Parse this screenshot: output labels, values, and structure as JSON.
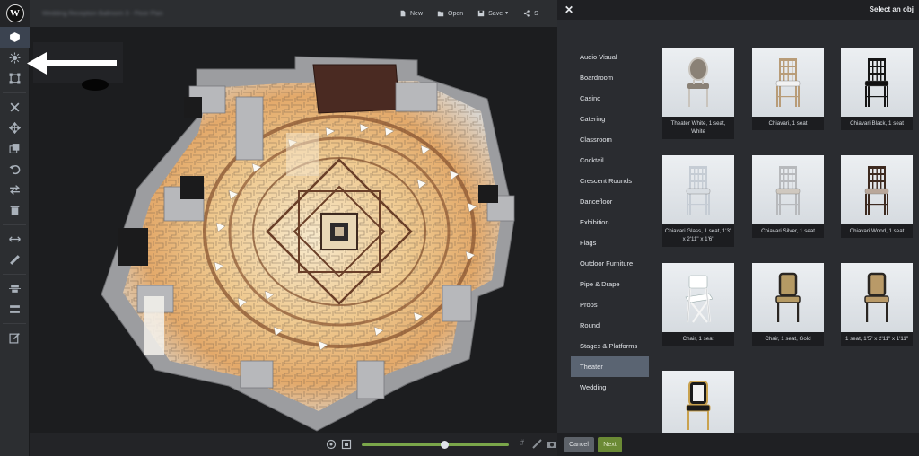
{
  "app": {
    "logo_letter": "W",
    "document_title": "Wedding Reception Ballroom 3 - Floor Plan"
  },
  "toolbar": {
    "items": [
      "cube-icon",
      "brightness-icon",
      "transform-icon",
      "close-icon",
      "move-icon",
      "copy-icon",
      "undo-icon",
      "swap-icon",
      "trash-icon",
      "resize-icon",
      "ruler-icon",
      "align-icon",
      "distribute-icon",
      "edit-icon"
    ],
    "active_index": 0
  },
  "topbar": {
    "new_label": "New",
    "open_label": "Open",
    "save_label": "Save",
    "share_label": "S"
  },
  "viewport": {
    "zoom_level": 0.56
  },
  "panel": {
    "title": "Select an obj",
    "categories": [
      "Audio Visual",
      "Boardroom",
      "Casino",
      "Catering",
      "Classroom",
      "Cocktail",
      "Crescent Rounds",
      "Dancefloor",
      "Exhibition",
      "Flags",
      "Outdoor Furniture",
      "Pipe & Drape",
      "Props",
      "Round",
      "Stages & Platforms",
      "Theater",
      "Wedding"
    ],
    "selected_category": "Theater",
    "items": [
      {
        "caption": "Theater White, 1 seat, White",
        "kind": "round-back-chair",
        "seat": "#8a8176",
        "frame": "#c9c4bd"
      },
      {
        "caption": "Chiavari, 1 seat",
        "kind": "chiavari",
        "seat": "#f2f2f2",
        "frame": "#b89c78"
      },
      {
        "caption": "Chiavari Black, 1 seat",
        "kind": "chiavari",
        "seat": "#111111",
        "frame": "#151515"
      },
      {
        "caption": "Chiavari Glass, 1 seat, 1'3\" x 2'11\" x 1'6\"",
        "kind": "chiavari",
        "seat": "#d8dde2",
        "frame": "#c5ccd4"
      },
      {
        "caption": "Chiavari Silver, 1 seat",
        "kind": "chiavari",
        "seat": "#cfc8bf",
        "frame": "#b7b9bc"
      },
      {
        "caption": "Chiavari Wood, 1 seat",
        "kind": "chiavari",
        "seat": "#b9a79a",
        "frame": "#3d2a20"
      },
      {
        "caption": "Chair, 1 seat",
        "kind": "folding",
        "seat": "#ffffff",
        "frame": "#f4f4f4"
      },
      {
        "caption": "Chair, 1 seat, Gold",
        "kind": "padded",
        "seat": "#b59a64",
        "frame": "#2a2622"
      },
      {
        "caption": "1 seat, 1'5\" x 2'11\" x 1'11\"",
        "kind": "padded",
        "seat": "#b99a68",
        "frame": "#2a2622"
      },
      {
        "caption": "",
        "kind": "banquet",
        "seat": "#1a1a1a",
        "frame": "#c9a24f"
      }
    ],
    "cancel_label": "Cancel",
    "next_label": "Next"
  },
  "colors": {
    "accent_green": "#6b8a35",
    "selected_category_bg": "#5a6472"
  }
}
